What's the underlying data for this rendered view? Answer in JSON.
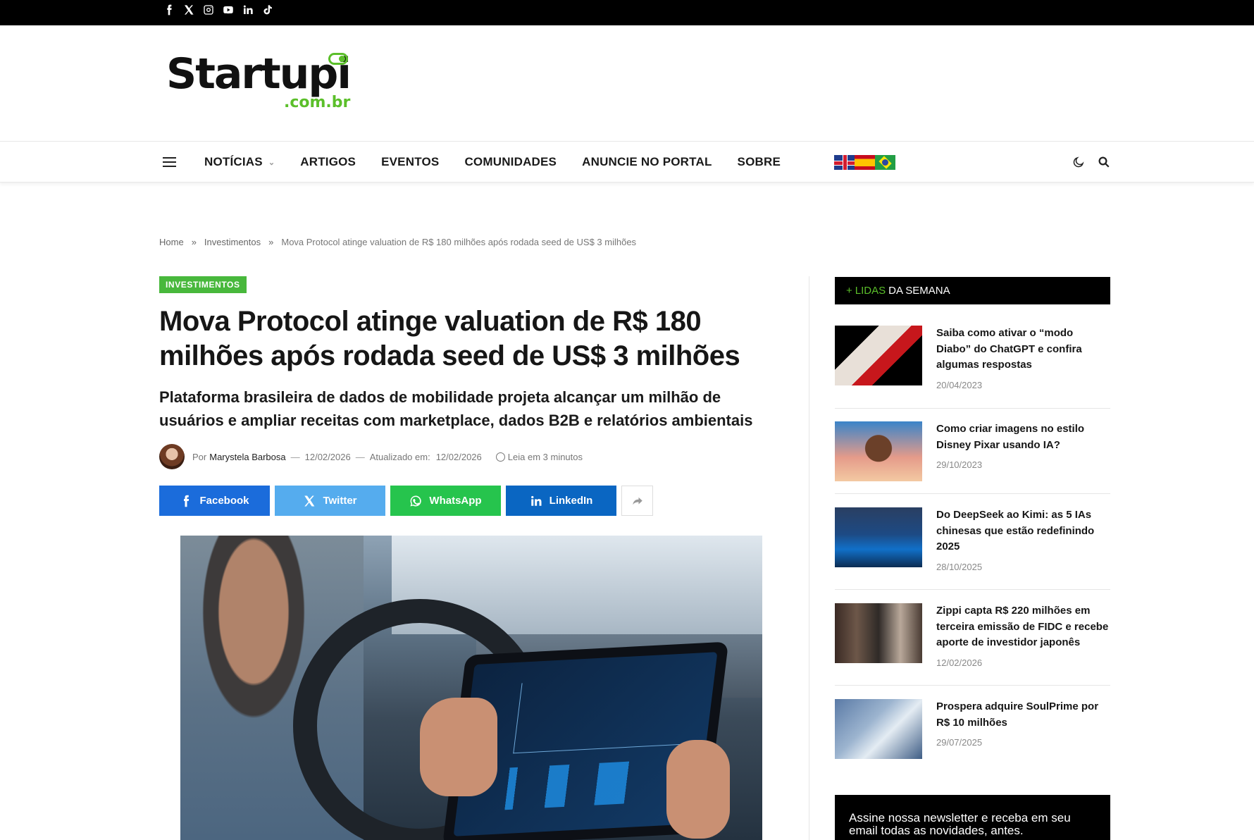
{
  "topbar": {
    "social_icons": [
      "facebook-icon",
      "x-icon",
      "instagram-icon",
      "youtube-icon",
      "linkedin-icon",
      "tiktok-icon"
    ]
  },
  "logo": {
    "name": "Startupi",
    "domain": ".com.br",
    "accent_color": "#5bbf2a"
  },
  "nav": {
    "items": [
      {
        "label": "NOTÍCIAS",
        "has_dropdown": true
      },
      {
        "label": "ARTIGOS"
      },
      {
        "label": "EVENTOS"
      },
      {
        "label": "COMUNIDADES"
      },
      {
        "label": "ANUNCIE NO PORTAL"
      },
      {
        "label": "SOBRE"
      }
    ],
    "flags": [
      "uk-flag",
      "spain-flag",
      "brazil-flag"
    ],
    "icons": [
      "dark-mode-icon",
      "search-icon"
    ]
  },
  "breadcrumb": {
    "home": "Home",
    "sep": "»",
    "category": "Investimentos",
    "current": "Mova Protocol atinge valuation de R$ 180 milhões após rodada seed de US$ 3 milhões"
  },
  "article": {
    "category": "INVESTIMENTOS",
    "category_color": "#48b83c",
    "title": "Mova Protocol atinge valuation de R$ 180 milhões após rodada seed de US$ 3 milhões",
    "subtitle": "Plataforma brasileira de dados de mobilidade projeta alcançar um milhão de usuários e ampliar receitas com marketplace, dados B2B e relatórios ambientais",
    "meta": {
      "by": "Por",
      "author": "Marystela Barbosa",
      "dash": "—",
      "date": "12/02/2026",
      "updated_label": "Atualizado em:",
      "updated_date": "12/02/2026",
      "read_time": "Leia em 3 minutos"
    },
    "share": {
      "facebook": "Facebook",
      "twitter": "Twitter",
      "whatsapp": "WhatsApp",
      "linkedin": "LinkedIn"
    }
  },
  "sidebar": {
    "heading_plus": "+",
    "heading_accent": "LIDAS",
    "heading_rest": "DA SEMANA",
    "posts": [
      {
        "title": "Saiba como ativar o “modo Diabo” do ChatGPT e confira algumas respostas",
        "date": "20/04/2023"
      },
      {
        "title": "Como criar imagens no estilo Disney Pixar usando IA?",
        "date": "29/10/2023"
      },
      {
        "title": "Do DeepSeek ao Kimi: as 5 IAs chinesas que estão redefinindo 2025",
        "date": "28/10/2025"
      },
      {
        "title": "Zippi capta R$ 220 milhões em terceira emissão de FIDC e recebe aporte de investidor japonês",
        "date": "12/02/2026"
      },
      {
        "title": "Prospera adquire SoulPrime por R$ 10 milhões",
        "date": "29/07/2025"
      }
    ],
    "newsletter": "Assine nossa newsletter e receba em seu email todas as novidades, antes."
  }
}
